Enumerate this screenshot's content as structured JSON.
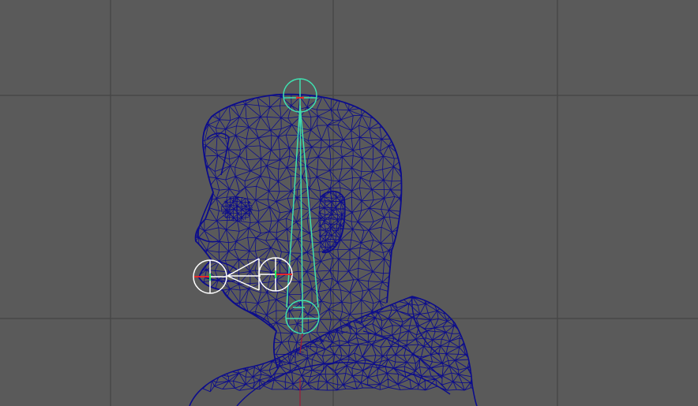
{
  "viewport": {
    "view": "perspective-side",
    "content": "wireframe-head-with-joint-rig"
  },
  "colors": {
    "background": "#5a5a5a",
    "grid": "#444444",
    "mesh": "#0c0c8c",
    "spine_joint": "#3fe0b0",
    "jaw_joint": "#ffffff",
    "axis_x": "#ff2020",
    "axis_z": "#20ff60"
  },
  "rig": {
    "joints": [
      {
        "name": "head-top-joint",
        "color_key": "spine_joint"
      },
      {
        "name": "neck-joint",
        "color_key": "spine_joint"
      },
      {
        "name": "jaw-pivot-joint",
        "color_key": "jaw_joint"
      },
      {
        "name": "jaw-tip-joint",
        "color_key": "jaw_joint"
      }
    ],
    "bones": [
      {
        "name": "head-bone",
        "from": "neck-joint",
        "to": "head-top-joint"
      },
      {
        "name": "jaw-bone",
        "from": "jaw-pivot-joint",
        "to": "jaw-tip-joint"
      }
    ]
  }
}
